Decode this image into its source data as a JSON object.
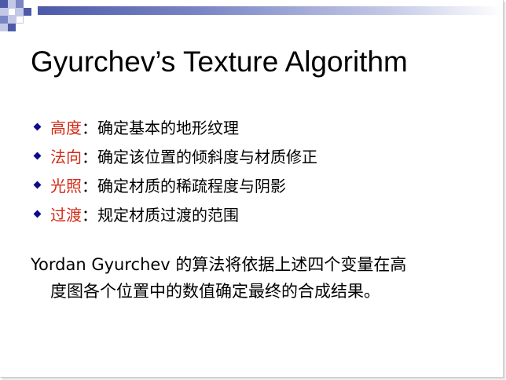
{
  "slide": {
    "title": "Gyurchev’s Texture Algorithm",
    "bullets": [
      {
        "term": "高度",
        "separator": "：",
        "description": "确定基本的地形纹理"
      },
      {
        "term": "法向",
        "separator": "：",
        "description": "确定该位置的倾斜度与材质修正"
      },
      {
        "term": "光照",
        "separator": "：",
        "description": "确定材质的稀疏程度与阴影"
      },
      {
        "term": "过渡",
        "separator": "：",
        "description": "规定材质过渡的范围"
      }
    ],
    "summary": {
      "line1": "Yordan Gyurchev 的算法将依据上述四个变量在高",
      "line2": "度图各个位置中的数值确定最终的合成结果。"
    }
  },
  "colors": {
    "term": "#d42a16",
    "bullet": "#0b0b8c",
    "header_bar": "#4d5aa8",
    "checker_dark": "#4d5aa8",
    "checker_light": "#c3c8e6"
  },
  "icons": {
    "bullet": "diamond-bullet-icon"
  }
}
